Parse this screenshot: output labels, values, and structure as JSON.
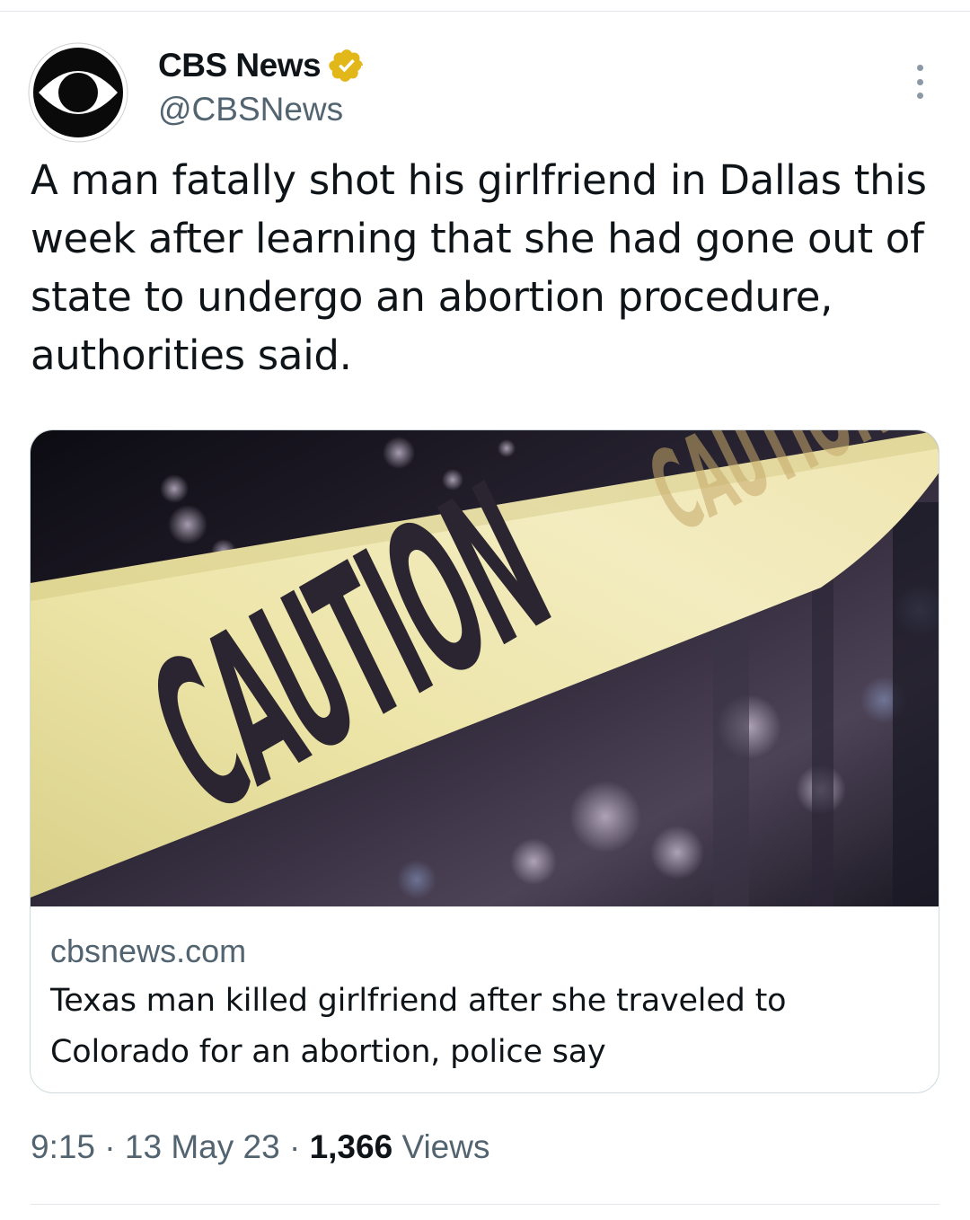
{
  "author": {
    "display_name": "CBS News",
    "handle": "@CBSNews",
    "avatar_icon": "cbs-eye-logo",
    "verified_icon": "verified-badge-icon",
    "verified_color": "#e2b719"
  },
  "tweet": {
    "text": "A man fatally shot his girlfriend in Dallas this week after learning that she had gone out of state to undergo an abortion procedure, authorities said."
  },
  "card": {
    "image_icon": "caution-tape-photo",
    "domain": "cbsnews.com",
    "title": "Texas man killed girlfriend after she traveled to Colorado for an abortion, police say"
  },
  "meta": {
    "time": "9:15",
    "separator": "·",
    "date": "13 May 23",
    "views_count": "1,366",
    "views_label": "Views"
  },
  "colors": {
    "text_primary": "#0f1419",
    "text_secondary": "#536471",
    "border": "#cfd9de"
  }
}
